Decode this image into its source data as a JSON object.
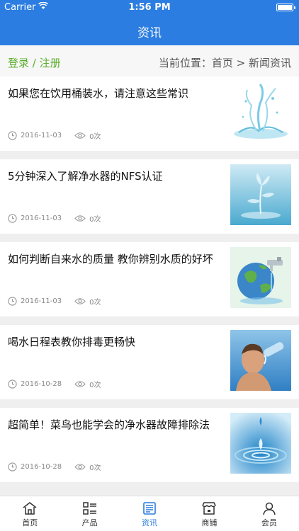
{
  "status": {
    "carrier": "Carrier",
    "time": "1:56 PM"
  },
  "header": {
    "title": "资讯"
  },
  "crumb": {
    "login": "登录 / 注册",
    "location": "当前位置：首页 > 新闻资讯"
  },
  "articles": [
    {
      "title": "如果您在饮用桶装水，请注意这些常识",
      "date": "2016-11-03",
      "views": "0次",
      "image": "water-splash"
    },
    {
      "title": "5分钟深入了解净水器的NFS认证",
      "date": "2016-11-03",
      "views": "0次",
      "image": "water-flower"
    },
    {
      "title": "如何判断自来水的质量 教你辨别水质的好坏",
      "date": "2016-11-03",
      "views": "0次",
      "image": "globe-faucet"
    },
    {
      "title": "喝水日程表教你排毒更畅快",
      "date": "2016-10-28",
      "views": "0次",
      "image": "man-drinking"
    },
    {
      "title": "超简单！菜鸟也能学会的净水器故障排除法",
      "date": "2016-10-28",
      "views": "0次",
      "image": "water-drop-ripple"
    }
  ],
  "tabs": [
    {
      "label": "首页",
      "icon": "home-icon"
    },
    {
      "label": "产品",
      "icon": "list-icon"
    },
    {
      "label": "资讯",
      "icon": "news-icon",
      "active": true
    },
    {
      "label": "商铺",
      "icon": "shop-icon"
    },
    {
      "label": "会员",
      "icon": "user-icon"
    }
  ],
  "colors": {
    "primary": "#2b7de1",
    "login": "#5cae2d"
  }
}
